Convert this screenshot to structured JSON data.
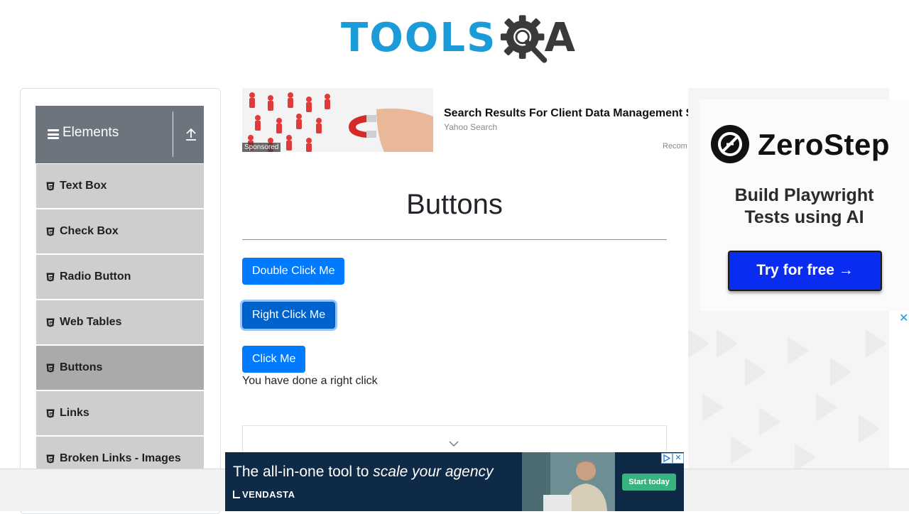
{
  "logo": {
    "text": "TOOLS",
    "suffix": "A",
    "colors": {
      "blue": "#1b9bd7",
      "dark": "#3a3a3a"
    }
  },
  "sidebar": {
    "group_title": "Elements",
    "items": [
      {
        "label": "Text Box"
      },
      {
        "label": "Check Box"
      },
      {
        "label": "Radio Button"
      },
      {
        "label": "Web Tables"
      },
      {
        "label": "Buttons",
        "active": true
      },
      {
        "label": "Links"
      },
      {
        "label": "Broken Links - Images"
      }
    ]
  },
  "top_ad": {
    "badge": "Sponsored",
    "title": "Search Results For Client Data Management S",
    "source": "Yahoo Search",
    "recommended": "Recom"
  },
  "main": {
    "title": "Buttons",
    "buttons": {
      "double_click": "Double Click Me",
      "right_click": "Right Click Me",
      "click": "Click Me"
    },
    "result_message": "You have done a right click"
  },
  "right_ad": {
    "brand": "ZeroStep",
    "tagline_line1": "Build Playwright",
    "tagline_line2": "Tests using AI",
    "cta": "Try for free →",
    "close": "✕"
  },
  "bottom_ad": {
    "headline_start": "The all-in-one tool to ",
    "headline_italic": "scale your agency",
    "brand": "VENDASTA",
    "cta": "Start today",
    "close": "✕"
  },
  "colors": {
    "primary": "#007bff",
    "sidebar_header": "#6c757d",
    "menu_bg": "#cecece",
    "menu_active": "#aaaaaa"
  }
}
